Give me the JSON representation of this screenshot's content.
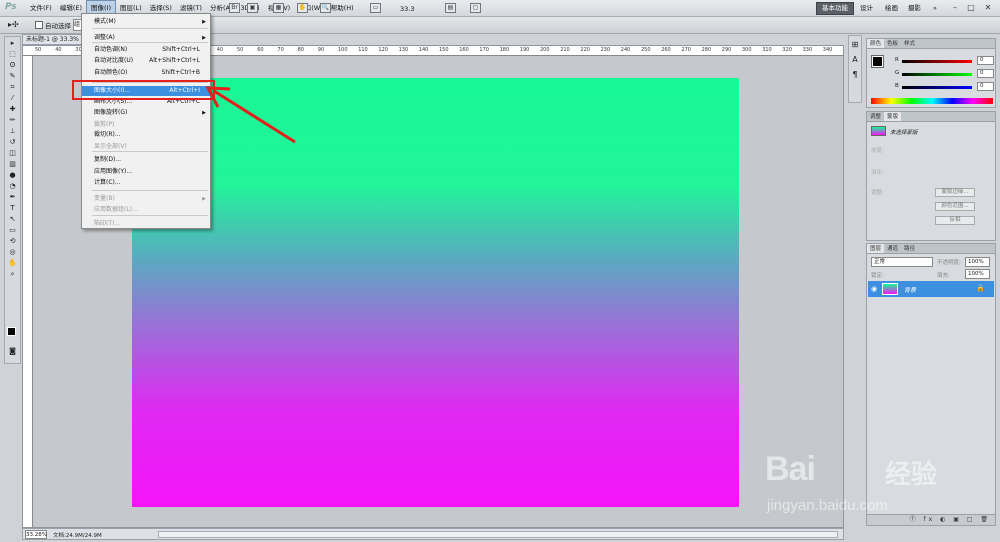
{
  "app": {
    "logo": "Ps"
  },
  "menubar": {
    "items": [
      {
        "label": "文件(F)"
      },
      {
        "label": "编辑(E)"
      },
      {
        "label": "图像(I)"
      },
      {
        "label": "图层(L)"
      },
      {
        "label": "选择(S)"
      },
      {
        "label": "滤镜(T)"
      },
      {
        "label": "分析(A)"
      },
      {
        "label": "3D(D)"
      },
      {
        "label": "视图(V)"
      },
      {
        "label": "窗口(W)"
      },
      {
        "label": "帮助(H)"
      }
    ],
    "zoom_value": "33.3",
    "workspaces": [
      "基本功能",
      "设计",
      "绘画",
      "摄影"
    ],
    "more": "»",
    "window_controls": [
      "–",
      "□",
      "✕"
    ]
  },
  "options_bar": {
    "auto_select_label": "自动选择",
    "group_select": "组"
  },
  "document": {
    "tab_title": "未标题-1 @ 33.3%",
    "ruler_ticks": [
      "50",
      "40",
      "30",
      "20",
      "10",
      "0",
      "10",
      "20",
      "30",
      "40",
      "50",
      "60",
      "70",
      "80",
      "90",
      "100",
      "110",
      "120",
      "130",
      "140",
      "150",
      "160",
      "170",
      "180",
      "190",
      "200",
      "210",
      "220",
      "230",
      "240",
      "250",
      "260",
      "270",
      "280",
      "290",
      "300",
      "310",
      "320",
      "330",
      "340",
      "350"
    ],
    "zoom_level": "33.28%",
    "doc_info": "文档:24.9M/24.9M"
  },
  "image_menu": {
    "items": [
      {
        "label": "模式(M)",
        "shortcut": "",
        "submenu": true,
        "disabled": false
      },
      {
        "label": "调整(A)",
        "shortcut": "",
        "submenu": true,
        "disabled": false
      },
      {
        "label": "自动色调(N)",
        "shortcut": "Shift+Ctrl+L",
        "submenu": false,
        "disabled": false
      },
      {
        "label": "自动对比度(U)",
        "shortcut": "Alt+Shift+Ctrl+L",
        "submenu": false,
        "disabled": false
      },
      {
        "label": "自动颜色(O)",
        "shortcut": "Shift+Ctrl+B",
        "submenu": false,
        "disabled": false
      },
      {
        "label": "图像大小(I)...",
        "shortcut": "Alt+Ctrl+I",
        "submenu": false,
        "disabled": false,
        "highlighted": true
      },
      {
        "label": "画布大小(S)...",
        "shortcut": "Alt+Ctrl+C",
        "submenu": false,
        "disabled": false
      },
      {
        "label": "图像旋转(G)",
        "shortcut": "",
        "submenu": true,
        "disabled": false
      },
      {
        "label": "裁剪(P)",
        "shortcut": "",
        "submenu": false,
        "disabled": true
      },
      {
        "label": "裁切(R)...",
        "shortcut": "",
        "submenu": false,
        "disabled": false
      },
      {
        "label": "显示全部(V)",
        "shortcut": "",
        "submenu": false,
        "disabled": true
      },
      {
        "label": "复制(D)...",
        "shortcut": "",
        "submenu": false,
        "disabled": false
      },
      {
        "label": "应用图像(Y)...",
        "shortcut": "",
        "submenu": false,
        "disabled": false
      },
      {
        "label": "计算(C)...",
        "shortcut": "",
        "submenu": false,
        "disabled": false
      },
      {
        "label": "变量(B)",
        "shortcut": "",
        "submenu": true,
        "disabled": true
      },
      {
        "label": "应用数据组(L)...",
        "shortcut": "",
        "submenu": false,
        "disabled": true
      },
      {
        "label": "陷印(T)...",
        "shortcut": "",
        "submenu": false,
        "disabled": true
      }
    ]
  },
  "color_panel": {
    "tabs": [
      "颜色",
      "色板",
      "样式"
    ],
    "rows": [
      {
        "label": "R",
        "value": "0"
      },
      {
        "label": "G",
        "value": "0"
      },
      {
        "label": "B",
        "value": "0"
      }
    ]
  },
  "adjustments_panel": {
    "tabs": [
      "调整",
      "蒙版"
    ],
    "title": "未选择蒙版",
    "rows": [
      "浓度:",
      "羽化:",
      "调整:"
    ],
    "buttons": [
      "蒙版边缘...",
      "颜色范围...",
      "反相"
    ]
  },
  "layers_panel": {
    "tabs": [
      "图层",
      "通道",
      "路径"
    ],
    "blend_mode": "正常",
    "opacity_label": "不透明度:",
    "opacity": "100%",
    "lock_label": "锁定:",
    "fill_label": "填充:",
    "fill": "100%",
    "layer_name": "背景",
    "footer_icons": "ⓕ fx ◐ ▣ □ 🗑"
  },
  "colors": {
    "canvas_top": "#18f896",
    "canvas_bottom": "#f514fa",
    "highlight": "#3d8fe0",
    "annotation": "#e3201b"
  },
  "watermark": {
    "brand": "Bai",
    "cn": "经验",
    "url": "jingyan.baidu.com"
  }
}
